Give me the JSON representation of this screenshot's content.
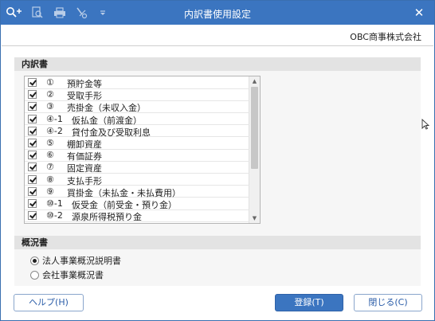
{
  "window": {
    "title": "内訳書使用設定",
    "company": "OBC商事株式会社"
  },
  "toolbar": {
    "icons": [
      "search-plus-icon",
      "zoom-icon",
      "printer-icon",
      "tool-icon",
      "dropdown-icon"
    ]
  },
  "uchiwake": {
    "header": "内訳書",
    "items": [
      {
        "num": "①",
        "label": "預貯金等",
        "checked": true
      },
      {
        "num": "②",
        "label": "受取手形",
        "checked": true
      },
      {
        "num": "③",
        "label": "売掛金（未収入金）",
        "checked": true
      },
      {
        "num": "④-1",
        "label": "仮払金（前渡金）",
        "checked": true
      },
      {
        "num": "④-2",
        "label": "貸付金及び受取利息",
        "checked": true
      },
      {
        "num": "⑤",
        "label": "棚卸資産",
        "checked": true
      },
      {
        "num": "⑥",
        "label": "有価証券",
        "checked": true
      },
      {
        "num": "⑦",
        "label": "固定資産",
        "checked": true
      },
      {
        "num": "⑧",
        "label": "支払手形",
        "checked": true
      },
      {
        "num": "⑨",
        "label": "買掛金（未払金・未払費用）",
        "checked": true
      },
      {
        "num": "⑩-1",
        "label": "仮受金（前受金・預り金）",
        "checked": true
      },
      {
        "num": "⑩-2",
        "label": "源泉所得税預り金",
        "checked": true
      }
    ]
  },
  "gaikyo": {
    "header": "概況書",
    "options": [
      {
        "label": "法人事業概況説明書",
        "selected": true
      },
      {
        "label": "会社事業概況書",
        "selected": false
      }
    ]
  },
  "buttons": {
    "help": "ヘルプ(H)",
    "register": "登録(T)",
    "close": "閉じる(C)"
  },
  "colors": {
    "titlebar": "#3b75c0",
    "accent": "#2b5da8"
  }
}
